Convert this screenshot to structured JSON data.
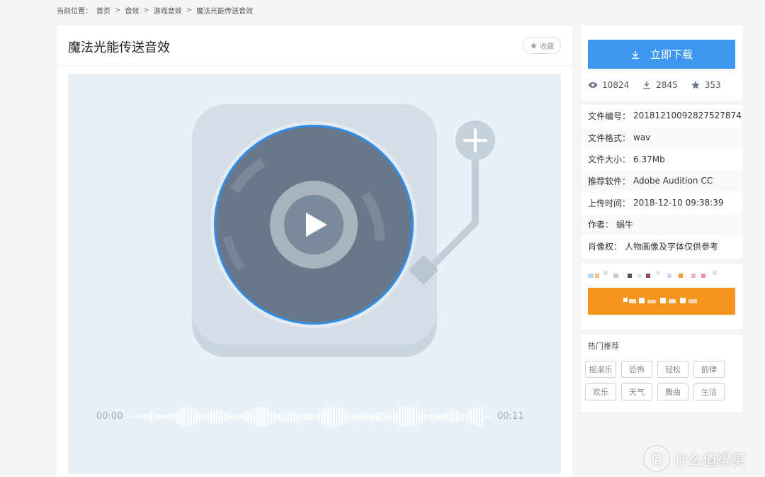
{
  "breadcrumb": {
    "prefix": "当前位置：",
    "items": [
      "首页",
      "音效",
      "游戏音效",
      "魔法光能传送音效"
    ],
    "separator": ">"
  },
  "page": {
    "title": "魔法光能传送音效",
    "favorite_label": "收藏"
  },
  "player": {
    "time_start": "00:00",
    "time_end": "00:11",
    "colors": {
      "background": "#e8f0f8",
      "deck": "#d5dee6",
      "record": "#68788a",
      "record_ring": "#2f8ee8",
      "arm": "#c1ced9"
    }
  },
  "download": {
    "button_label": "立即下载",
    "views": "10824",
    "downloads": "2845",
    "favorites": "353",
    "accent_color": "#3d96f0"
  },
  "file_info": [
    {
      "label": "文件编号：",
      "value": "20181210092827527874"
    },
    {
      "label": "文件格式：",
      "value": "wav"
    },
    {
      "label": "文件大小：",
      "value": "6.37Mb"
    },
    {
      "label": "推荐软件：",
      "value": "Adobe Audition CC"
    },
    {
      "label": "上传时间：",
      "value": "2018-12-10 09:38:39"
    },
    {
      "label": "作者：",
      "value": "蜗牛"
    },
    {
      "label": "肖像权：",
      "value": "人物画像及字体仅供参考"
    }
  ],
  "ad": {
    "button_color": "#f5931e"
  },
  "hot": {
    "title": "热门推荐",
    "tags": [
      "摇滚乐",
      "恐怖",
      "轻松",
      "韵律",
      "欢乐",
      "天气",
      "舞曲",
      "生活"
    ]
  },
  "watermark": {
    "logo_glyph": "值",
    "text": "什么值得买"
  }
}
